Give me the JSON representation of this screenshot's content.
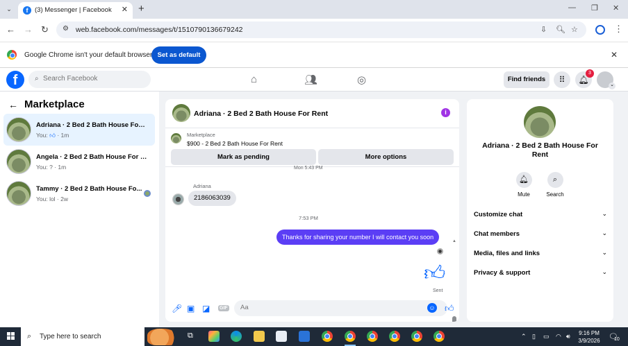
{
  "browser": {
    "tab_title": "(3) Messenger | Facebook",
    "url": "web.facebook.com/messages/t/1510790136679242",
    "default_prompt": "Google Chrome isn't your default browser",
    "set_default_label": "Set as default"
  },
  "fb_header": {
    "search_placeholder": "Search Facebook",
    "find_friends_label": "Find friends",
    "notification_count": "3"
  },
  "sidebar": {
    "title": "Marketplace",
    "conversations": [
      {
        "name": "Adriana · 2 Bed 2 Bath House For ...",
        "preview_prefix": "You:",
        "preview_time": "· 1m"
      },
      {
        "name": "Angela · 2 Bed 2 Bath House For R...",
        "preview": "You: ? · 1m"
      },
      {
        "name": "Tammy · 2 Bed 2 Bath House Fo...",
        "preview": "You: lol · 2w"
      }
    ]
  },
  "chat": {
    "title": "Adriana · 2 Bed 2 Bath House For Rent",
    "listing_tag": "Marketplace",
    "listing_price": "$900 - 2 Bed 2 Bath House For Rent",
    "mark_pending_label": "Mark as pending",
    "more_options_label": "More options",
    "date_cut": "Mon 5:43 PM",
    "sender_name": "Adriana",
    "incoming_message": "2186063039",
    "time_separator": "7:53 PM",
    "outgoing_message": "Thanks for sharing your number I will contact you soon",
    "status": "Sent",
    "composer_placeholder": "Aa",
    "gif_label": "GIF"
  },
  "details": {
    "name": "Adriana · 2 Bed 2 Bath House For Rent",
    "mute_label": "Mute",
    "search_label": "Search",
    "sections": [
      "Customize chat",
      "Chat members",
      "Media, files and links",
      "Privacy & support"
    ]
  },
  "taskbar": {
    "search_text": "Type here to search",
    "time": "9:16 PM",
    "date": "3/9/2026",
    "notification_count": "10"
  }
}
